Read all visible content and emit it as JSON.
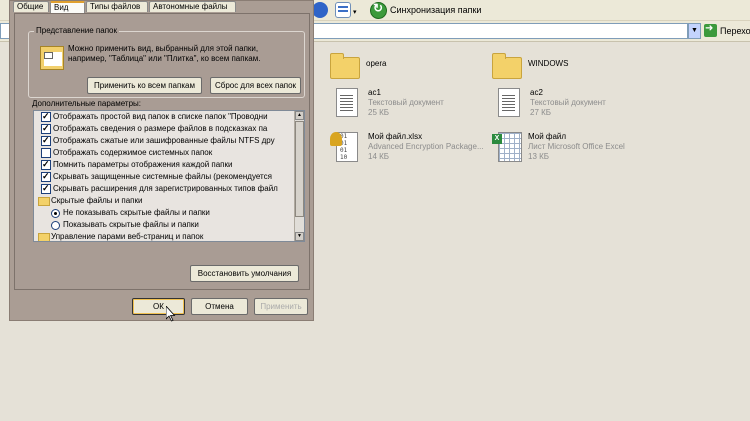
{
  "toolbar": {
    "sync_label": "Синхронизация папки",
    "view_icon": "views-icon",
    "sync_icon": "sync-icon"
  },
  "address_bar": {
    "value": "",
    "go_label": "Перехо"
  },
  "files": [
    {
      "name": "opera",
      "kind": "folder",
      "type": "",
      "size": ""
    },
    {
      "name": "WINDOWS",
      "kind": "folder",
      "type": "",
      "size": ""
    },
    {
      "name": "ac1",
      "kind": "text",
      "type": "Текстовый документ",
      "size": "25 КБ"
    },
    {
      "name": "ac2",
      "kind": "text",
      "type": "Текстовый документ",
      "size": "27 КБ"
    },
    {
      "name": "Мой файл.xlsx",
      "kind": "encrypted",
      "type": "Advanced Encryption Package...",
      "size": "14 КБ"
    },
    {
      "name": "Мой файл",
      "kind": "excel",
      "type": "Лист Microsoft Office Excel",
      "size": "13 КБ"
    }
  ],
  "dialog": {
    "tabs": [
      {
        "label": "Общие",
        "active": false
      },
      {
        "label": "Вид",
        "active": true
      },
      {
        "label": "Типы файлов",
        "active": false
      },
      {
        "label": "Автономные файлы",
        "active": false
      }
    ],
    "folder_views": {
      "legend": "Представление папок",
      "description": "Можно применить вид, выбранный для этой папки, например, \"Таблица\" или \"Плитка\", ко всем папкам.",
      "apply_all": "Применить ко всем папкам",
      "reset_all": "Сброс для всех папок"
    },
    "advanced_label": "Дополнительные параметры:",
    "settings": [
      {
        "kind": "check",
        "checked": true,
        "indent": 0,
        "label": "Отображать простой вид папок в списке папок \"Проводни"
      },
      {
        "kind": "check",
        "checked": true,
        "indent": 0,
        "label": "Отображать сведения о размере файлов в подсказках па"
      },
      {
        "kind": "check",
        "checked": true,
        "indent": 0,
        "label": "Отображать сжатые или зашифрованные файлы NTFS дру"
      },
      {
        "kind": "check",
        "checked": false,
        "indent": 0,
        "label": "Отображать содержимое системных папок"
      },
      {
        "kind": "check",
        "checked": true,
        "indent": 0,
        "label": "Помнить параметры отображения каждой папки"
      },
      {
        "kind": "check",
        "checked": true,
        "indent": 0,
        "label": "Скрывать защищенные системные файлы (рекомендуется"
      },
      {
        "kind": "check",
        "checked": true,
        "indent": 0,
        "label": "Скрывать расширения для зарегистрированных типов файл"
      },
      {
        "kind": "folder",
        "checked": false,
        "indent": -1,
        "label": "Скрытые файлы и папки"
      },
      {
        "kind": "radio",
        "checked": true,
        "indent": 1,
        "label": "Не показывать скрытые файлы и папки"
      },
      {
        "kind": "radio",
        "checked": false,
        "indent": 1,
        "label": "Показывать скрытые файлы и папки"
      },
      {
        "kind": "folder",
        "checked": false,
        "indent": -1,
        "label": "Управление парами веб-страниц и папок"
      }
    ],
    "restore_defaults": "Восстановить умолчания",
    "ok": "ОК",
    "cancel": "Отмена",
    "apply": "Применить"
  }
}
